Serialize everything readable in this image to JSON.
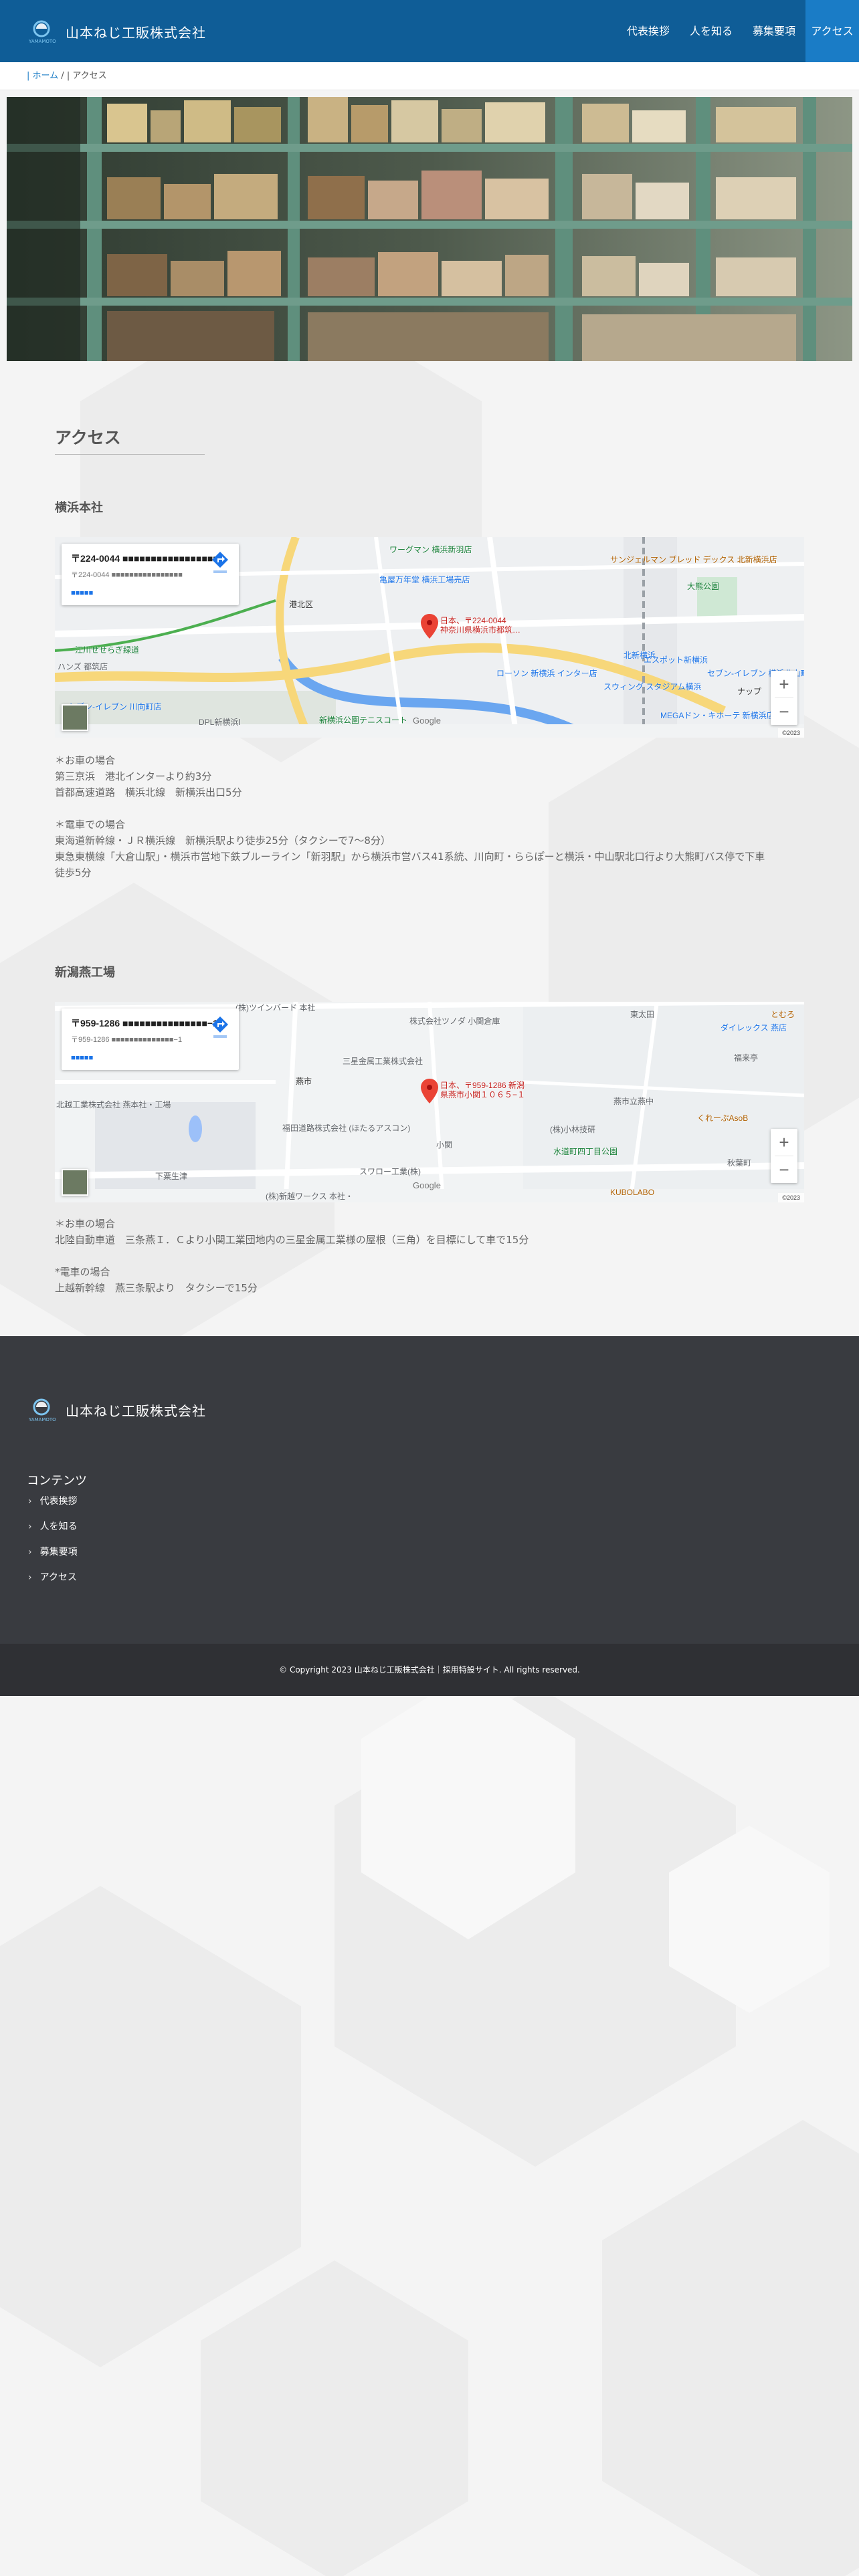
{
  "site": {
    "logo_sub": "YAMAMOTO",
    "name": "山本ねじ工販株式会社"
  },
  "nav": {
    "items": [
      {
        "label": "代表挨拶"
      },
      {
        "label": "人を知る"
      },
      {
        "label": "募集要項"
      },
      {
        "label": "アクセス",
        "active": true
      }
    ]
  },
  "breadcrumb": {
    "home": "ホーム",
    "separator": "/",
    "current": "アクセス"
  },
  "page": {
    "title": "アクセス"
  },
  "yokohama": {
    "title": "横浜本社",
    "map": {
      "card_title": "〒224-0044 ■■■■■■■■■■■■■■■■■",
      "card_address": "〒224-0044 ■■■■■■■■■■■■■■■■",
      "card_link": "■■■■■",
      "pin_line1": "日本、〒224-0044",
      "pin_line2": "神奈川県横浜市都筑…",
      "labels": [
        "ワーグマン 横浜新羽店",
        "亀屋万年堂 横浜工場売店",
        "港北区",
        "江川せせらぎ緑道",
        "ハンズ 都筑店",
        "北新横浜",
        "ローソン 新横浜 インター店",
        "スウィング スタジアム横浜",
        "DPL新横浜Ⅰ",
        "新横浜公園テニスコート",
        "セブン-イレブン 川向町店",
        "MEGAドン・キホーテ 新横浜店",
        "サンジェルマン ブレッド デックス 北新横浜店",
        "大熊公園",
        "エスポット新横浜",
        "セブン-イレブン 横浜北山町店",
        "ナップ"
      ],
      "google": "Google",
      "footer": "©2023"
    },
    "text": "＊お車の場合\n第三京浜　港北インターより約3分\n首都高速道路　横浜北線　新横浜出口5分\n\n＊電車での場合\n東海道新幹線・ＪＲ横浜線　新横浜駅より徒歩25分（タクシーで7～8分）\n東急東横線「大倉山駅」・横浜市営地下鉄ブルーライン「新羽駅」から横浜市営バス41系統、川向町・ららぽーと横浜・中山駅北口行より大熊町バス停で下車\n徒歩5分"
  },
  "niigata": {
    "title": "新潟燕工場",
    "map": {
      "card_title": "〒959-1286 ■■■■■■■■■■■■■■■−1",
      "card_address": "〒959-1286 ■■■■■■■■■■■■■■−1",
      "card_link": "■■■■■",
      "pin_line1": "日本、〒959-1286 新潟",
      "pin_line2": "県燕市小関１０６５−１",
      "labels": [
        "(株)ツインバード 本社",
        "株式会社ツノダ 小関倉庫",
        "東太田",
        "ダイレックス 燕店",
        "燕市",
        "三星金属工業株式会社",
        "北越工業株式会社 燕本社・工場",
        "福田道路株式会社 (ほたるアスコン)",
        "小関",
        "スワロー工業(株)",
        "(株)小林技研",
        "水道町四丁目公園",
        "燕市立燕中",
        "くれーぷAsoB",
        "(株)新越ワークス 本社・",
        "下粟生津",
        "KUBOLABO",
        "秋葉町",
        "福来亭",
        "とむろ"
      ],
      "google": "Google",
      "footer": "©2023"
    },
    "text": "＊お車の場合\n北陸自動車道　三条燕Ｉ．Ｃより小関工業団地内の三星金属工業様の屋根（三角）を目標にして車で15分\n\n*電車の場合\n上越新幹線　燕三条駅より　タクシーで15分"
  },
  "footer": {
    "heading": "コンテンツ",
    "links": [
      {
        "label": "代表挨拶"
      },
      {
        "label": "人を知る"
      },
      {
        "label": "募集要項"
      },
      {
        "label": "アクセス"
      }
    ],
    "copyright": "© Copyright 2023 山本ねじ工販株式会社｜採用特設サイト. All rights reserved."
  },
  "colors": {
    "header_bg": "#0f5d97",
    "nav_active": "#1a7cc6",
    "footer_bg": "#393b40",
    "copy_bg": "#2f3034",
    "map_pin": "#ea4335"
  }
}
